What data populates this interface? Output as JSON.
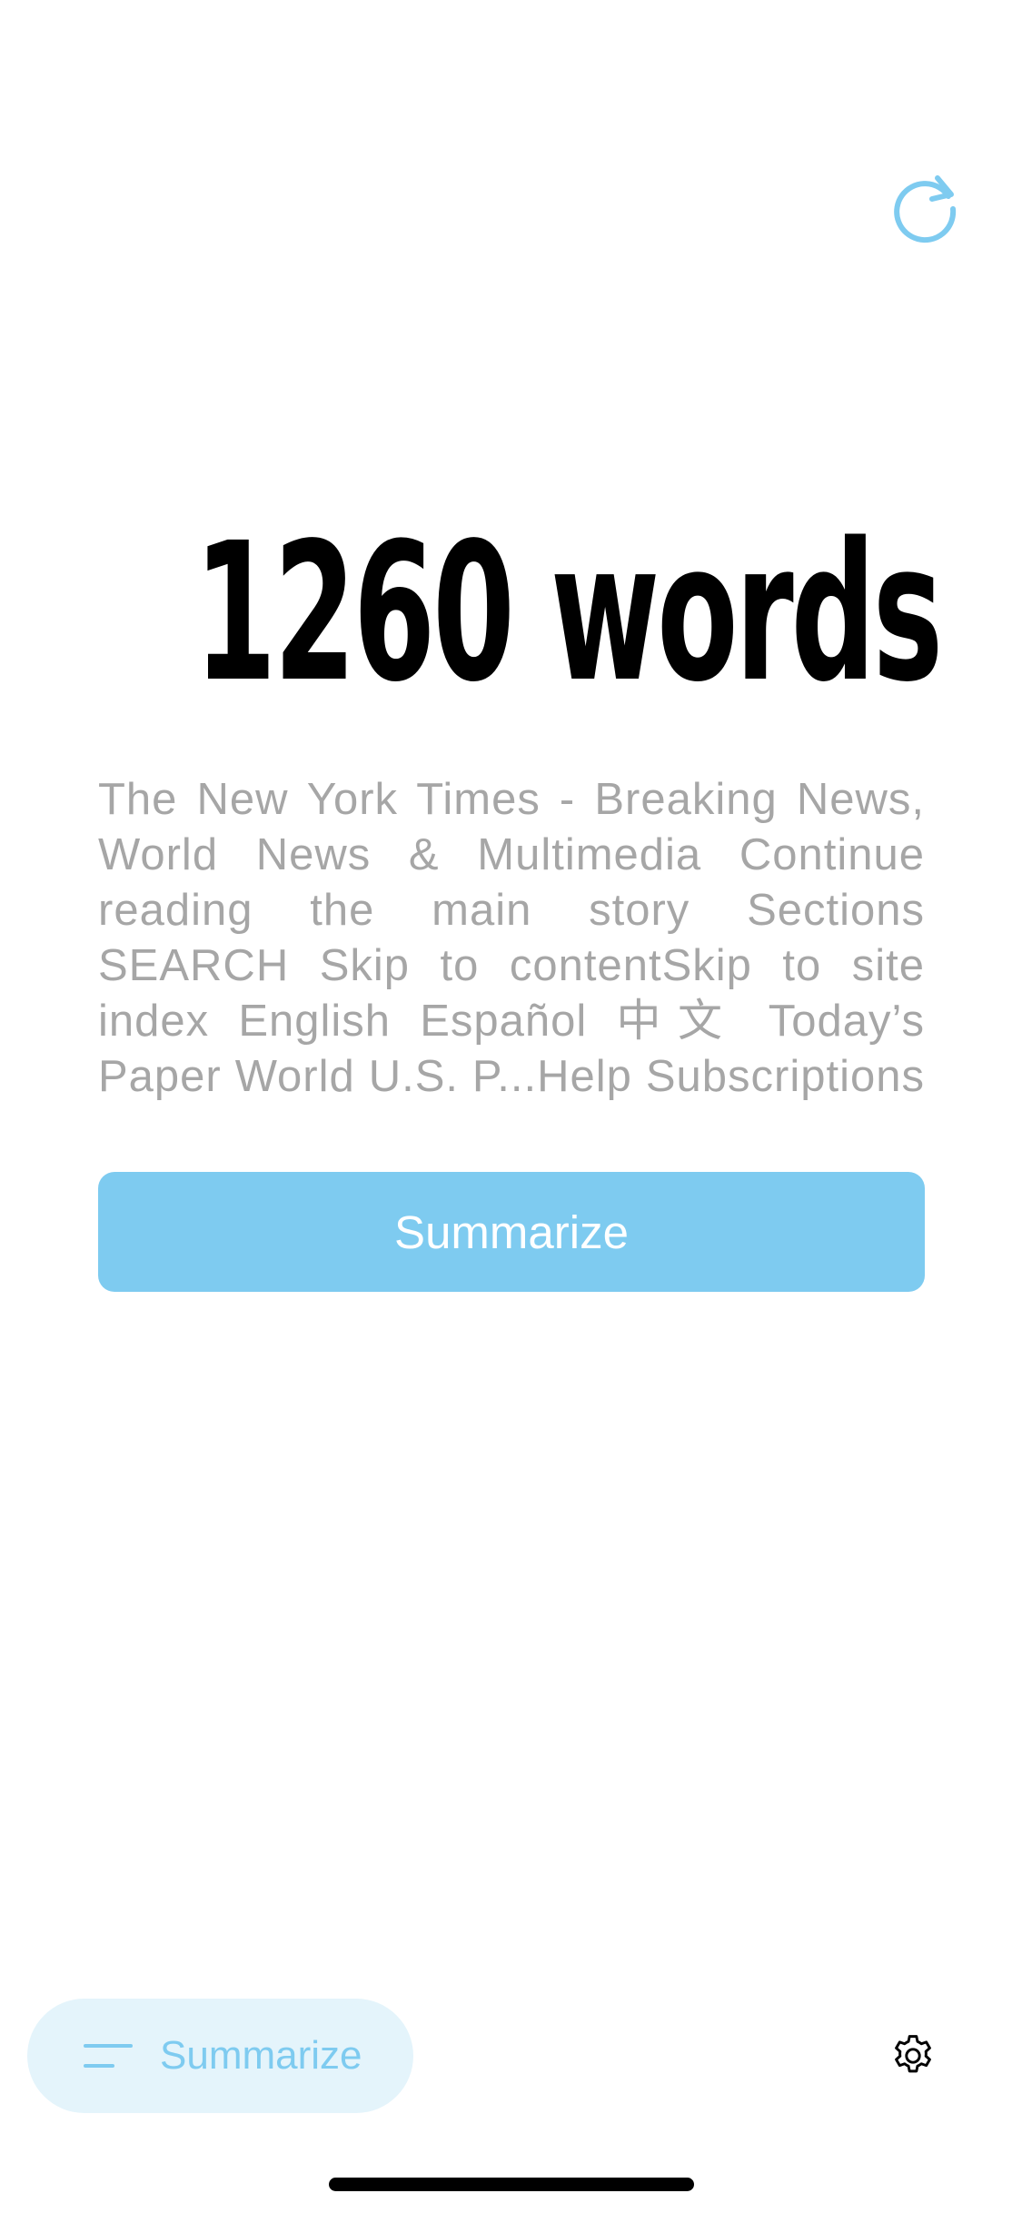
{
  "header": {
    "refresh_icon": "refresh-icon",
    "accent_color": "#7ecbf0"
  },
  "main": {
    "word_count": "1260 words",
    "excerpt": "The New York Times - Breaking News, World News & Multimedia Continue reading the main story Sections SEARCH Skip to contentSkip to site index English Español 中文 Today’s Paper World U.S. P...Help Subscriptions",
    "summarize_button_label": "Summarize",
    "button_color": "#7ecbf0"
  },
  "bottom_bar": {
    "pill_icon": "list-icon",
    "pill_label": "Summarize",
    "pill_background": "#e4f4fb",
    "settings_icon": "gear-icon"
  }
}
